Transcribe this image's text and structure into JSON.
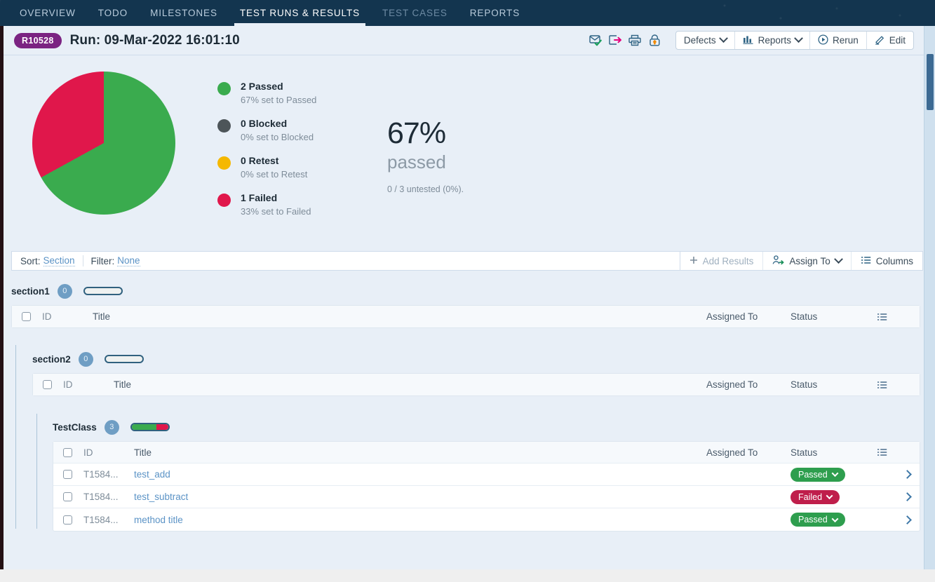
{
  "topnav": {
    "tabs": [
      {
        "label": "OVERVIEW",
        "active": false
      },
      {
        "label": "TODO",
        "active": false
      },
      {
        "label": "MILESTONES",
        "active": false
      },
      {
        "label": "TEST RUNS & RESULTS",
        "active": true
      },
      {
        "label": "TEST CASES",
        "active": false
      },
      {
        "label": "REPORTS",
        "active": false
      }
    ]
  },
  "header": {
    "run_badge": "R10528",
    "title": "Run: 09-Mar-2022 16:01:10",
    "icons": [
      "envelope-check-icon",
      "export-icon",
      "print-icon",
      "lock-icon"
    ],
    "buttons": {
      "defects": "Defects",
      "reports": "Reports",
      "rerun": "Rerun",
      "edit": "Edit"
    }
  },
  "chart_data": {
    "type": "pie",
    "title": "",
    "categories": [
      "Passed",
      "Blocked",
      "Retest",
      "Failed"
    ],
    "values": [
      2,
      0,
      0,
      1
    ],
    "percents": [
      67,
      0,
      0,
      33
    ],
    "colors": [
      "#3aab4e",
      "#4d5559",
      "#f5b800",
      "#e0174b"
    ],
    "legend_position": "right",
    "legend": [
      {
        "count_label": "2 Passed",
        "sub_label": "67% set to Passed",
        "color": "#3aab4e"
      },
      {
        "count_label": "0 Blocked",
        "sub_label": "0% set to Blocked",
        "color": "#4d5559"
      },
      {
        "count_label": "0 Retest",
        "sub_label": "0% set to Retest",
        "color": "#f5b800"
      },
      {
        "count_label": "1 Failed",
        "sub_label": "33% set to Failed",
        "color": "#e0174b"
      }
    ],
    "summary": {
      "percent": "67%",
      "word": "passed",
      "untested": "0 / 3 untested (0%)."
    }
  },
  "filterbar": {
    "sort_label": "Sort:",
    "sort_value": "Section",
    "filter_label": "Filter:",
    "filter_value": "None",
    "add_results": "Add Results",
    "assign_to": "Assign To",
    "columns": "Columns"
  },
  "columns": {
    "id": "ID",
    "title": "Title",
    "assigned_to": "Assigned To",
    "status": "Status"
  },
  "sections": [
    {
      "name": "section1",
      "count": "0",
      "pass_pct": 0,
      "fail_pct": 0,
      "rows": []
    },
    {
      "name": "section2",
      "count": "0",
      "pass_pct": 0,
      "fail_pct": 0,
      "rows": []
    },
    {
      "name": "TestClass",
      "count": "3",
      "pass_pct": 67,
      "fail_pct": 33,
      "rows": [
        {
          "id": "T1584...",
          "title": "test_add",
          "assigned_to": "",
          "status": "Passed",
          "status_kind": "passed"
        },
        {
          "id": "T1584...",
          "title": "test_subtract",
          "assigned_to": "",
          "status": "Failed",
          "status_kind": "failed"
        },
        {
          "id": "T1584...",
          "title": "method title",
          "assigned_to": "",
          "status": "Passed",
          "status_kind": "passed"
        }
      ]
    }
  ]
}
